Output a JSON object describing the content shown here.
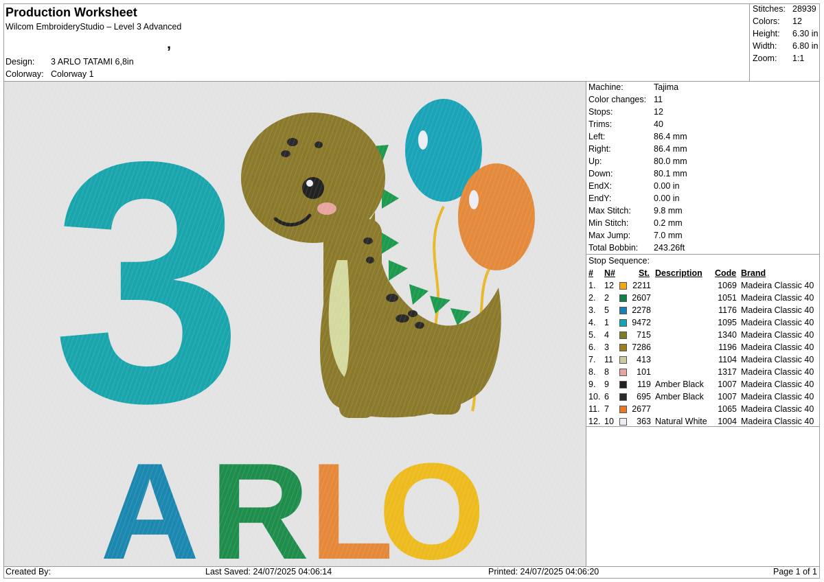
{
  "header": {
    "title": "Production Worksheet",
    "software": "Wilcom EmbroideryStudio – Level 3 Advanced",
    "mark": "’",
    "design_label": "Design:",
    "design_value": "3 ARLO TATAMI 6,8in",
    "colorway_label": "Colorway:",
    "colorway_value": "Colorway 1"
  },
  "summary": [
    {
      "label": "Stitches:",
      "value": "28939"
    },
    {
      "label": "Colors:",
      "value": "12"
    },
    {
      "label": "Height:",
      "value": "6.30 in"
    },
    {
      "label": "Width:",
      "value": "6.80 in"
    },
    {
      "label": "Zoom:",
      "value": "1:1"
    }
  ],
  "machine_info": [
    {
      "label": "Machine:",
      "value": "Tajima"
    },
    {
      "label": "Color changes:",
      "value": "11"
    },
    {
      "label": "Stops:",
      "value": "12"
    },
    {
      "label": "Trims:",
      "value": "40"
    },
    {
      "label": "Left:",
      "value": "86.4 mm"
    },
    {
      "label": "Right:",
      "value": "86.4 mm"
    },
    {
      "label": "Up:",
      "value": "80.0 mm"
    },
    {
      "label": "Down:",
      "value": "80.1 mm"
    },
    {
      "label": "EndX:",
      "value": "0.00 in"
    },
    {
      "label": "EndY:",
      "value": "0.00 in"
    },
    {
      "label": "Max Stitch:",
      "value": "9.8 mm"
    },
    {
      "label": "Min Stitch:",
      "value": "0.2 mm"
    },
    {
      "label": "Max Jump:",
      "value": "7.0 mm"
    },
    {
      "label": "Total Bobbin:",
      "value": "243.26ft"
    }
  ],
  "stop_sequence": {
    "label": "Stop Sequence:",
    "headers": {
      "index": "#",
      "needle": "N#",
      "stitches": "St.",
      "description": "Description",
      "code": "Code",
      "brand": "Brand"
    },
    "rows": [
      {
        "index": "1.",
        "needle": "12",
        "color": "#f3a712",
        "stitches": "2211",
        "description": "",
        "code": "1069",
        "brand": "Madeira Classic 40"
      },
      {
        "index": "2.",
        "needle": "2",
        "color": "#10804a",
        "stitches": "2607",
        "description": "",
        "code": "1051",
        "brand": "Madeira Classic 40"
      },
      {
        "index": "3.",
        "needle": "5",
        "color": "#1b7fb5",
        "stitches": "2278",
        "description": "",
        "code": "1176",
        "brand": "Madeira Classic 40"
      },
      {
        "index": "4.",
        "needle": "1",
        "color": "#12a6b5",
        "stitches": "9472",
        "description": "",
        "code": "1095",
        "brand": "Madeira Classic 40"
      },
      {
        "index": "5.",
        "needle": "4",
        "color": "#7f7a24",
        "stitches": "715",
        "description": "",
        "code": "1340",
        "brand": "Madeira Classic 40"
      },
      {
        "index": "6.",
        "needle": "3",
        "color": "#9c7d20",
        "stitches": "7286",
        "description": "",
        "code": "1196",
        "brand": "Madeira Classic 40"
      },
      {
        "index": "7.",
        "needle": "11",
        "color": "#c9cc9a",
        "stitches": "413",
        "description": "",
        "code": "1104",
        "brand": "Madeira Classic 40"
      },
      {
        "index": "8.",
        "needle": "8",
        "color": "#e8a4a0",
        "stitches": "101",
        "description": "",
        "code": "1317",
        "brand": "Madeira Classic 40"
      },
      {
        "index": "9.",
        "needle": "9",
        "color": "#222222",
        "stitches": "119",
        "description": "Amber Black",
        "code": "1007",
        "brand": "Madeira Classic 40"
      },
      {
        "index": "10.",
        "needle": "6",
        "color": "#2a2a2a",
        "stitches": "695",
        "description": "Amber Black",
        "code": "1007",
        "brand": "Madeira Classic 40"
      },
      {
        "index": "11.",
        "needle": "7",
        "color": "#e27a2a",
        "stitches": "2677",
        "description": "",
        "code": "1065",
        "brand": "Madeira Classic 40"
      },
      {
        "index": "12.",
        "needle": "10",
        "color": "#eceef4",
        "stitches": "363",
        "description": "Natural White",
        "code": "1004",
        "brand": "Madeira Classic 40"
      }
    ]
  },
  "preview": {
    "digit": "3",
    "name_letters": [
      "A",
      "R",
      "L",
      "O"
    ],
    "digit_color": "#1aa5ad",
    "letter_colors": [
      "#1c88b0",
      "#1f8e4d",
      "#e5883a",
      "#edbb1e"
    ],
    "dino_color": "#8b7a2c",
    "belly_color": "#d4d99f",
    "spike_color": "#1d9a4d",
    "balloon_colors": [
      "#1ba3b8",
      "#e48a3c"
    ],
    "string_color": "#e8b82a"
  },
  "footer": {
    "created_by": "Created By:",
    "last_saved": "Last Saved: 24/07/2025 04:06:14",
    "printed": "Printed: 24/07/2025 04:06:20",
    "page": "Page 1 of 1"
  }
}
